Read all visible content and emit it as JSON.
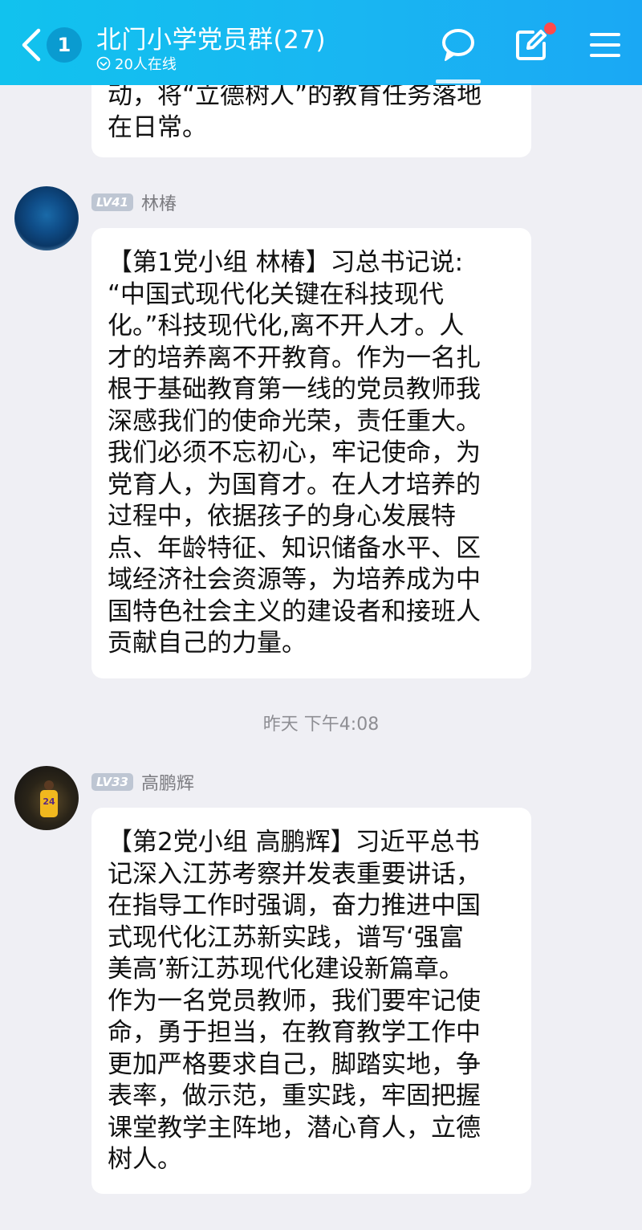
{
  "header": {
    "unread_count": "1",
    "title": "北门小学党员群(27)",
    "online_status": "20人在线",
    "icons": [
      "back-icon",
      "online-status-icon",
      "chat-bubble-icon",
      "edit-icon",
      "menu-icon"
    ],
    "accent_color": "#19b6f2",
    "notification_dot_color": "#ff4a4a"
  },
  "messages": {
    "partial": {
      "lines": [
        "动，将“立德树人”的教育任务落地",
        "在日常。"
      ]
    },
    "msg1": {
      "level": "LV41",
      "sender": "林椿",
      "lines": [
        "【第1党小组 林椿】习总书记说:",
        "“中国式现代化关键在科技现代",
        "化。”科技现代化,离不开人才。人",
        "才的培养离不开教育。作为一名扎",
        "根于基础教育第一线的党员教师我",
        "深感我们的使命光荣，责任重大。",
        "我们必须不忘初心，牢记使命，为",
        "党育人，为国育才。在人才培养的",
        "过程中，依据孩子的身心发展特",
        "点、年龄特征、知识储备水平、区",
        "域经济社会资源等，为培养成为中",
        "国特色社会主义的建设者和接班人",
        "贡献自己的力量。"
      ]
    },
    "timestamp": "昨天 下午4:08",
    "msg2": {
      "level": "LV33",
      "sender": "高鹏辉",
      "avatar_jersey": "24",
      "lines": [
        "【第2党小组 高鹏辉】习近平总书",
        "记深入江苏考察并发表重要讲话，",
        "在指导工作时强调，奋力推进中国",
        "式现代化江苏新实践，谱写‘强富",
        "美高’新江苏现代化建设新篇章。",
        "作为一名党员教师，我们要牢记使",
        "命，勇于担当，在教育教学工作中",
        "更加严格要求自己，脚踏实地，争",
        "表率，做示范，重实践，牢固把握",
        "课堂教学主阵地，潜心育人，立德",
        "树人。"
      ]
    }
  }
}
